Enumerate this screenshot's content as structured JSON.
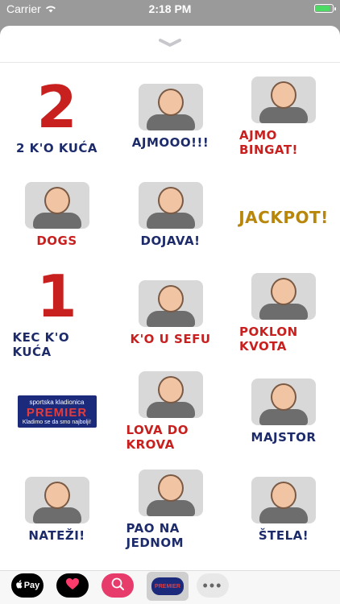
{
  "status_bar": {
    "carrier": "Carrier",
    "time": "2:18 PM"
  },
  "stickers": [
    {
      "caption": "2 K'O KUĆA",
      "kind": "big-number",
      "number": "2",
      "color": "navy"
    },
    {
      "caption": "AJMOOO!!!",
      "kind": "man",
      "color": "navy"
    },
    {
      "caption": "AJMO BINGAT!",
      "kind": "man",
      "color": "red"
    },
    {
      "caption": "DOGS",
      "kind": "man",
      "color": "red"
    },
    {
      "caption": "DOJAVA!",
      "kind": "man",
      "color": "navy"
    },
    {
      "caption": "JACKPOT!",
      "kind": "text",
      "color": "gold"
    },
    {
      "caption": "KEC K'O KUĆA",
      "kind": "big-number",
      "number": "1",
      "color": "navy"
    },
    {
      "caption": "K'O U SEFU",
      "kind": "man",
      "color": "red"
    },
    {
      "caption": "POKLON KVOTA",
      "kind": "man",
      "color": "red"
    },
    {
      "caption": "",
      "kind": "premier-logo",
      "logo": {
        "top": "sportska kladionica",
        "brand": "PREMIER",
        "sub": "Kladimo se da smo najbolji!"
      }
    },
    {
      "caption": "LOVA DO KROVA",
      "kind": "man",
      "color": "red"
    },
    {
      "caption": "MAJSTOR",
      "kind": "man",
      "color": "navy"
    },
    {
      "caption": "NATEŽI!",
      "kind": "man",
      "color": "navy"
    },
    {
      "caption": "PAO NA JEDNOM",
      "kind": "man",
      "color": "navy"
    },
    {
      "caption": "ŠTELA!",
      "kind": "man",
      "color": "navy"
    }
  ],
  "dock": {
    "apple_pay_label": "Pay",
    "more_label": "•••"
  }
}
